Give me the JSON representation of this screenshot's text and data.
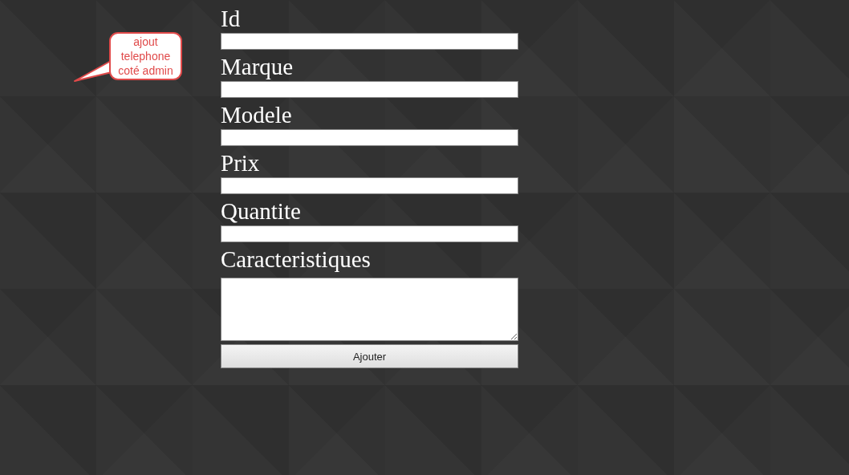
{
  "callout": {
    "text": "ajout telephone coté admin"
  },
  "fields": [
    {
      "label": "Id",
      "kind": "input"
    },
    {
      "label": "Marque",
      "kind": "input"
    },
    {
      "label": "Modele",
      "kind": "input"
    },
    {
      "label": "Prix",
      "kind": "input"
    },
    {
      "label": "Quantite",
      "kind": "input"
    },
    {
      "label": "Caracteristiques",
      "kind": "textarea"
    }
  ],
  "submit": {
    "label": "Ajouter"
  }
}
